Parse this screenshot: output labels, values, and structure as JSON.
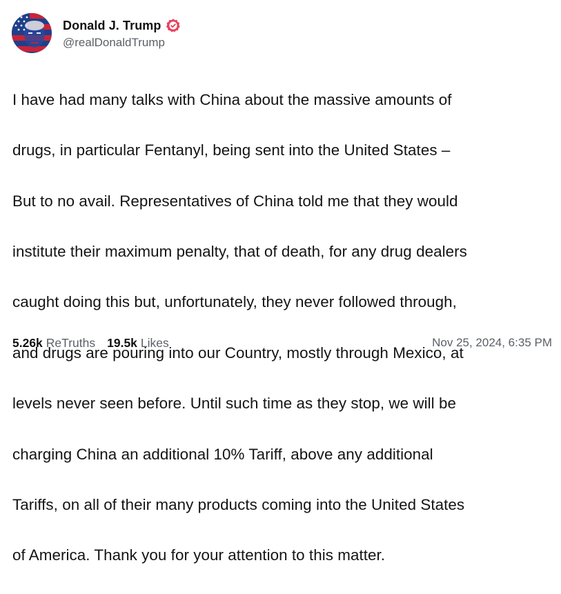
{
  "author": {
    "display_name": "Donald J. Trump",
    "handle": "@realDonaldTrump",
    "avatar_icon": "profile-avatar",
    "verified_icon": "verified-badge-icon",
    "verified_color": "#e8425f"
  },
  "post": {
    "lines": [
      "I have had many talks with China about the massive amounts of",
      "drugs, in particular Fentanyl, being sent into the United States –",
      "But to no avail. Representatives of China told me that they would",
      "institute their maximum penalty, that of death, for any drug dealers",
      "caught doing this but, unfortunately, they never followed through,",
      "and drugs are pouring into our Country, mostly through Mexico, at",
      "levels never seen before. Until such time as they stop, we will be",
      "charging China an additional 10% Tariff, above any additional",
      "Tariffs, on all of their many products coming into the United States",
      "of America. Thank you for your attention to this matter."
    ]
  },
  "stats": {
    "retruths_count": "5.26k",
    "retruths_label": "ReTruths",
    "likes_count": "19.5k",
    "likes_label": "Likes"
  },
  "timestamp": "Nov 25, 2024, 6:35 PM"
}
